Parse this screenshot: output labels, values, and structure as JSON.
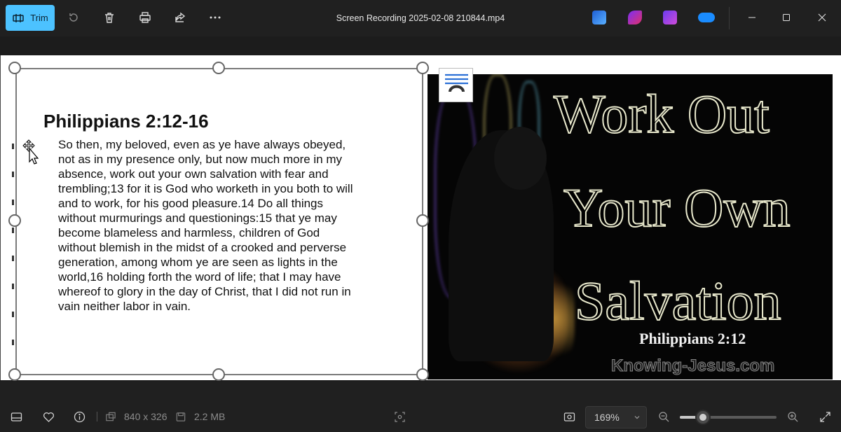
{
  "toolbar": {
    "trim_label": "Trim",
    "file_title": "Screen Recording 2025-02-08 210844.mp4"
  },
  "document": {
    "title": "Philippians 2:12-16",
    "lines": [
      "So then, my beloved, even as ye have always obeyed,",
      "not as in my presence only, but now much more in my",
      "absence, work out your own salvation with fear and",
      "trembling;13  for it is God who worketh in you both to will",
      "and to work, for his good pleasure.14 Do all things",
      "without murmurings and questionings:15  that ye may",
      "become blameless and harmless, children of God",
      "without blemish in the midst of a crooked and perverse",
      "generation, among whom ye are seen as lights in the",
      "world,16  holding forth the word of life; that I may have",
      "whereof to glory in the day of Christ, that I did not run in",
      "vain neither labor in vain."
    ]
  },
  "image": {
    "line1": "Work Out",
    "line2": "Your Own",
    "line3": "Salvation",
    "reference": "Philippians 2:12",
    "site": "Knowing-Jesus.com"
  },
  "status": {
    "dimensions": "840 x 326",
    "file_size": "2.2 MB",
    "zoom": "169%",
    "zoom_level_fraction": 0.24
  },
  "colors": {
    "accent": "#4cc2ff",
    "toolbar_bg": "#202020"
  }
}
